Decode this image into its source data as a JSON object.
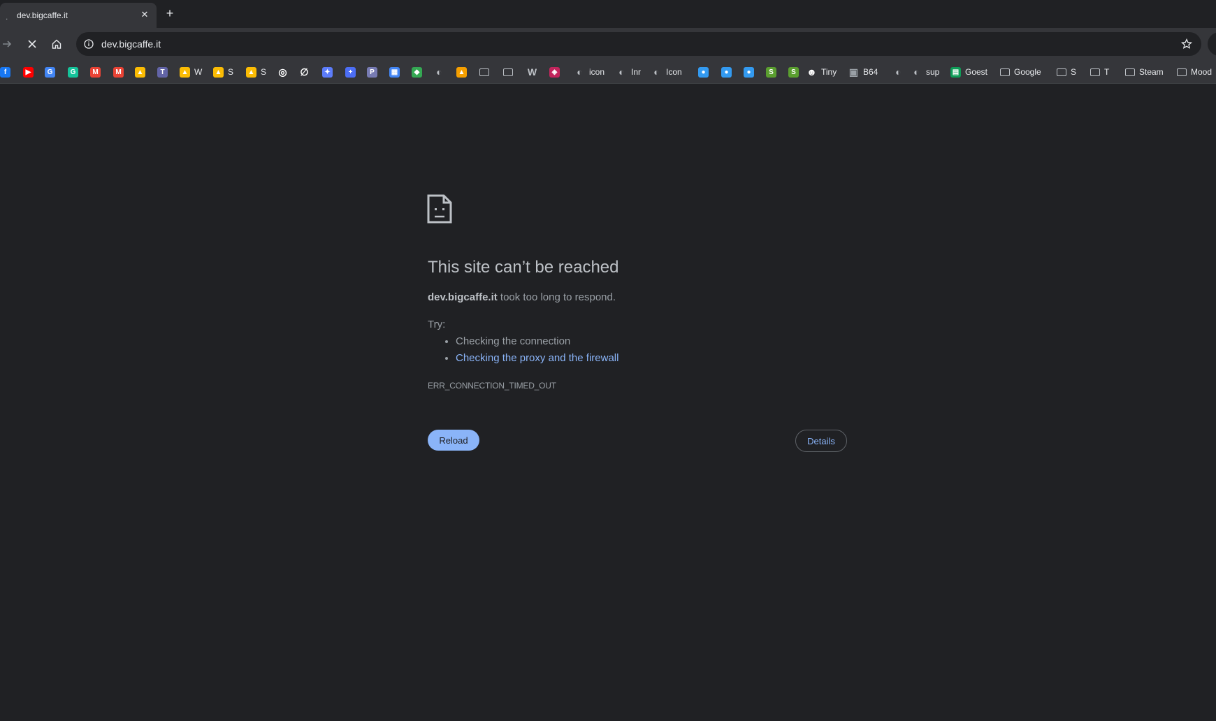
{
  "tab": {
    "loader": ".",
    "title": "dev.bigcaffe.it",
    "close": "✕",
    "new_tab": "+"
  },
  "toolbar": {
    "url": "dev.bigcaffe.it",
    "forward_icon": "arrow-right-icon",
    "stop_icon": "stop-x-icon",
    "home_icon": "home-icon",
    "info_icon": "info-icon",
    "star_icon": "star-icon"
  },
  "bookmarks": [
    {
      "icon": "facebook-icon",
      "color": "#1877f2",
      "glyph": "f",
      "label": ""
    },
    {
      "icon": "youtube-icon",
      "color": "#ff0000",
      "glyph": "▶",
      "label": ""
    },
    {
      "icon": "google-translate-icon",
      "color": "#4285f4",
      "glyph": "G",
      "label": ""
    },
    {
      "icon": "grammarly-icon",
      "color": "#15c39a",
      "glyph": "G",
      "label": ""
    },
    {
      "icon": "gmail-icon",
      "color": "#ea4335",
      "glyph": "M",
      "label": ""
    },
    {
      "icon": "gmail-icon",
      "color": "#ea4335",
      "glyph": "M",
      "label": ""
    },
    {
      "icon": "google-drive-icon",
      "color": "#fbbc04",
      "glyph": "▲",
      "label": ""
    },
    {
      "icon": "teams-icon",
      "color": "#6264a7",
      "glyph": "T",
      "label": ""
    },
    {
      "icon": "google-drive-icon",
      "color": "#fbbc04",
      "glyph": "▲",
      "label": "W"
    },
    {
      "icon": "google-drive-icon",
      "color": "#fbbc04",
      "glyph": "▲",
      "label": "S"
    },
    {
      "icon": "google-drive-icon",
      "color": "#fbbc04",
      "glyph": "▲",
      "label": "S"
    },
    {
      "icon": "target-icon",
      "color": "#ffffff",
      "glyph": "◎",
      "label": ""
    },
    {
      "icon": "no-icon",
      "color": "#ffffff",
      "glyph": "∅",
      "label": ""
    },
    {
      "icon": "tool-icon",
      "color": "#5c7cfa",
      "glyph": "✦",
      "label": ""
    },
    {
      "icon": "plus-circle-icon",
      "color": "#4c6ef5",
      "glyph": "+",
      "label": ""
    },
    {
      "icon": "php-icon",
      "color": "#777bb3",
      "glyph": "P",
      "label": ""
    },
    {
      "icon": "apps-grid-icon",
      "color": "#4285f4",
      "glyph": "▦",
      "label": ""
    },
    {
      "icon": "maps-pin-icon",
      "color": "#34a853",
      "glyph": "◆",
      "label": ""
    },
    {
      "icon": "globe-icon",
      "color": "#bdc1c6",
      "glyph": "◐",
      "label": ""
    },
    {
      "icon": "triangle-logo-icon",
      "color": "#f59f00",
      "glyph": "▲",
      "label": ""
    },
    {
      "icon": "folder-icon",
      "color": "transparent",
      "glyph": "▭",
      "label": ""
    },
    {
      "icon": "folder-icon",
      "color": "transparent",
      "glyph": "▭",
      "label": ""
    },
    {
      "icon": "wordpress-icon",
      "color": "#bdc1c6",
      "glyph": "W",
      "label": ""
    },
    {
      "icon": "shield-icon",
      "color": "#c2255c",
      "glyph": "◈",
      "label": ""
    },
    {
      "icon": "globe-icon",
      "color": "#bdc1c6",
      "glyph": "◐",
      "label": "icon"
    },
    {
      "icon": "globe-icon",
      "color": "#bdc1c6",
      "glyph": "◐",
      "label": "Inr"
    },
    {
      "icon": "globe-icon",
      "color": "#bdc1c6",
      "glyph": "◐",
      "label": "Icon"
    },
    {
      "icon": "pill-icon",
      "color": "#339af0",
      "glyph": "●",
      "label": ""
    },
    {
      "icon": "pill-icon",
      "color": "#339af0",
      "glyph": "●",
      "label": ""
    },
    {
      "icon": "pill-icon",
      "color": "#339af0",
      "glyph": "●",
      "label": ""
    },
    {
      "icon": "shopify-icon",
      "color": "#5a9e2f",
      "glyph": "S",
      "label": ""
    },
    {
      "icon": "shopify-icon",
      "color": "#5a9e2f",
      "glyph": "S",
      "label": ""
    },
    {
      "icon": "tiny-icon",
      "color": "#ffffff",
      "glyph": "☻",
      "label": "Tiny"
    },
    {
      "icon": "image-icon",
      "color": "#9aa0a6",
      "glyph": "▣",
      "label": "B64"
    },
    {
      "icon": "globe-icon",
      "color": "#bdc1c6",
      "glyph": "◐",
      "label": ""
    },
    {
      "icon": "globe-icon",
      "color": "#bdc1c6",
      "glyph": "◐",
      "label": "sup"
    },
    {
      "icon": "sheets-icon",
      "color": "#0f9d58",
      "glyph": "▤",
      "label": "Goest"
    },
    {
      "icon": "folder-icon",
      "color": "transparent",
      "glyph": "▭",
      "label": "Google"
    },
    {
      "icon": "folder-icon",
      "color": "transparent",
      "glyph": "▭",
      "label": "S"
    },
    {
      "icon": "folder-icon",
      "color": "transparent",
      "glyph": "▭",
      "label": "T"
    },
    {
      "icon": "folder-icon",
      "color": "transparent",
      "glyph": "▭",
      "label": "Steam"
    },
    {
      "icon": "folder-icon",
      "color": "transparent",
      "glyph": "▭",
      "label": "Mood"
    }
  ],
  "error": {
    "title": "This site can’t be reached",
    "host": "dev.bigcaffe.it",
    "message": " took too long to respond.",
    "try_label": "Try:",
    "suggestion_1": "Checking the connection",
    "suggestion_2": "Checking the proxy and the firewall",
    "code": "ERR_CONNECTION_TIMED_OUT",
    "reload_label": "Reload",
    "details_label": "Details"
  },
  "colors": {
    "background": "#202124",
    "toolbar": "#35363a",
    "accent": "#8ab4f8"
  }
}
